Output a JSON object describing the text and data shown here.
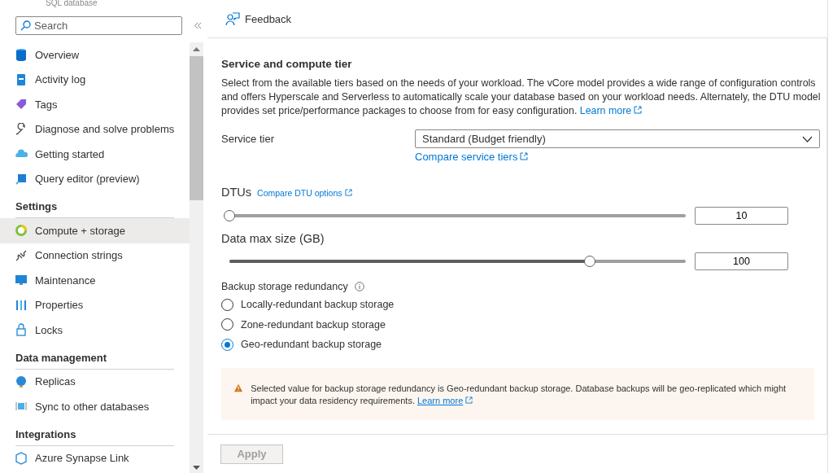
{
  "resource": {
    "subtitle": "SQL database"
  },
  "sidebar": {
    "search": {
      "placeholder": "Search"
    },
    "sections": [
      {
        "items": [
          {
            "label": "Overview",
            "selected": false
          },
          {
            "label": "Activity log",
            "selected": false
          },
          {
            "label": "Tags",
            "selected": false
          },
          {
            "label": "Diagnose and solve problems",
            "selected": false
          },
          {
            "label": "Getting started",
            "selected": false
          },
          {
            "label": "Query editor (preview)",
            "selected": false
          }
        ]
      },
      {
        "heading": "Settings",
        "items": [
          {
            "label": "Compute + storage",
            "selected": true
          },
          {
            "label": "Connection strings",
            "selected": false
          },
          {
            "label": "Maintenance",
            "selected": false
          },
          {
            "label": "Properties",
            "selected": false
          },
          {
            "label": "Locks",
            "selected": false
          }
        ]
      },
      {
        "heading": "Data management",
        "items": [
          {
            "label": "Replicas",
            "selected": false
          },
          {
            "label": "Sync to other databases",
            "selected": false
          }
        ]
      },
      {
        "heading": "Integrations",
        "items": [
          {
            "label": "Azure Synapse Link",
            "selected": false
          }
        ]
      }
    ]
  },
  "toolbar": {
    "feedback": "Feedback"
  },
  "form": {
    "title": "Service and compute tier",
    "description": "Select from the available tiers based on the needs of your workload. The vCore model provides a wide range of configuration controls and offers Hyperscale and Serverless to automatically scale your database based on your workload needs. Alternately, the DTU model provides set price/performance packages to choose from for easy configuration.",
    "description_link": "Learn more",
    "service_tier": {
      "label": "Service tier",
      "value": "Standard (Budget friendly)",
      "link": "Compare service tiers"
    },
    "sliders": [
      {
        "label": "DTUs",
        "link": "Compare DTU options",
        "level": 0,
        "value": "10"
      },
      {
        "label": "Data max size (GB)",
        "level": 0.77,
        "value": "100"
      }
    ],
    "backup": {
      "label": "Backup storage redundancy",
      "options": [
        {
          "label": "Locally-redundant backup storage",
          "selected": false
        },
        {
          "label": "Zone-redundant backup storage",
          "selected": false
        },
        {
          "label": "Geo-redundant backup storage",
          "selected": true
        }
      ]
    },
    "warning": {
      "text": "Selected value for backup storage redundancy is Geo-redundant backup storage. Database backups will be geo-replicated which might impact your data residency requirements.",
      "link": "Learn more"
    }
  },
  "footer": {
    "apply": {
      "label": "Apply",
      "disabled": true
    }
  }
}
